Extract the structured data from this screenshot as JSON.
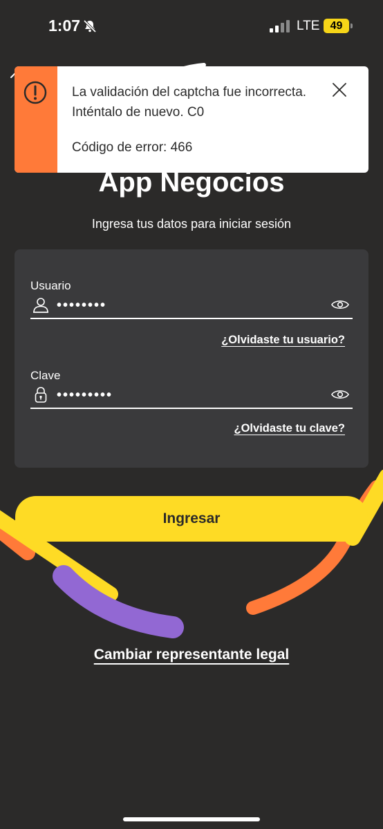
{
  "status_bar": {
    "time": "1:07",
    "network": "LTE",
    "battery": "49",
    "icons": [
      "bell-slash-icon",
      "signal-icon",
      "battery-icon"
    ]
  },
  "toast": {
    "message": "La validación del captcha fue incorrecta. Inténtalo de nuevo. C0",
    "error_code": "Código de error: 466",
    "icon": "alert-icon",
    "accent_color": "#ff7a39"
  },
  "header": {
    "title": "App Negocios",
    "subtitle": "Ingresa tus datos para iniciar sesión"
  },
  "form": {
    "user": {
      "label": "Usuario",
      "value": "••••••••",
      "icon": "user-icon",
      "forgot_link": "¿Olvidaste tu usuario?"
    },
    "password": {
      "label": "Clave",
      "value": "•••••••••",
      "icon": "lock-icon",
      "forgot_link": "¿Olvidaste tu clave?"
    }
  },
  "actions": {
    "login_label": "Ingresar",
    "change_legal_rep": "Cambiar representante legal"
  },
  "colors": {
    "background": "#2b2a29",
    "card": "#3a3a3c",
    "primary_yellow": "#fedb25",
    "orange": "#ff7a39",
    "purple": "#9268d3"
  }
}
